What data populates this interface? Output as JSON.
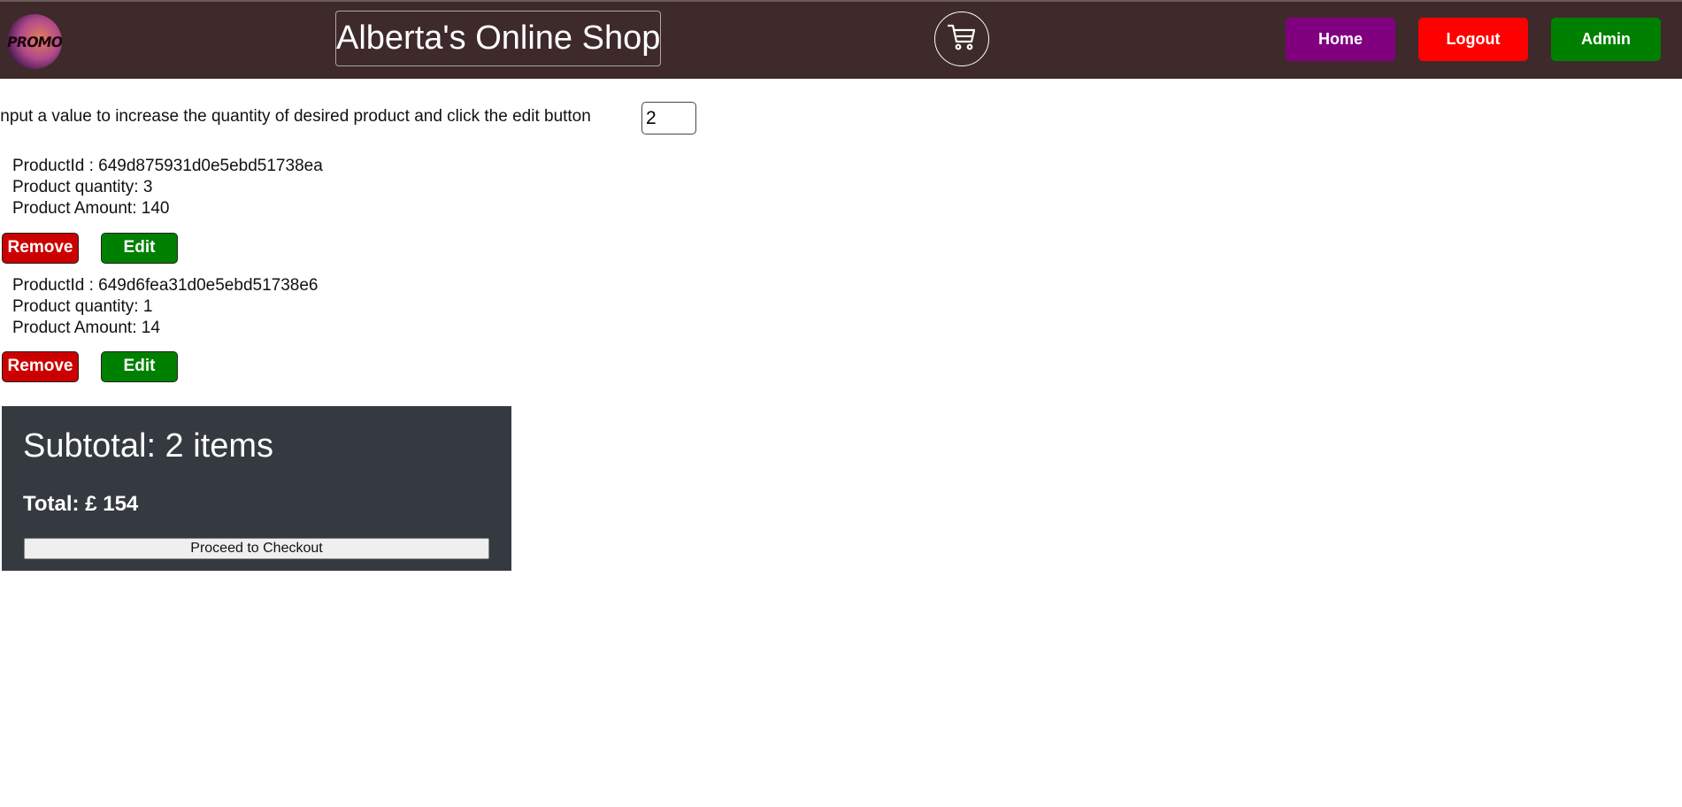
{
  "header": {
    "logo_text": "PROMO",
    "title": "Alberta's Online Shop",
    "cart_icon": "shopping-cart-icon",
    "nav": {
      "home": "Home",
      "logout": "Logout",
      "admin": "Admin"
    },
    "colors": {
      "bar": "#3e2a2a",
      "home": "#800080",
      "logout": "#ff0000",
      "admin": "#008000"
    }
  },
  "cart": {
    "instruction": "Input a value to increase the quantity of desired product and click the edit button",
    "quantity_input_value": "2",
    "items": [
      {
        "product_id": "ProductId : 649d875931d0e5ebd51738ea",
        "quantity": "Product quantity: 3",
        "amount": "Product Amount: 140",
        "remove_label": "Remove",
        "edit_label": "Edit"
      },
      {
        "product_id": "ProductId : 649d6fea31d0e5ebd51738e6",
        "quantity": "Product quantity: 1",
        "amount": "Product Amount: 14",
        "remove_label": "Remove",
        "edit_label": "Edit"
      }
    ]
  },
  "summary": {
    "subtotal": "Subtotal: 2 items",
    "total": "Total: £ 154",
    "checkout_label": "Proceed to Checkout",
    "background": "#343a40"
  }
}
